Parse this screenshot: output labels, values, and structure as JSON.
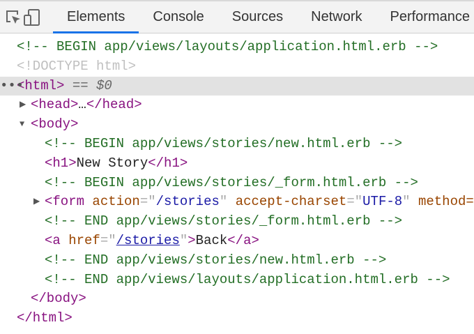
{
  "toolbar": {
    "tools": [
      {
        "icon": "inspect-element-icon"
      },
      {
        "icon": "device-toolbar-icon"
      }
    ],
    "tabs": [
      {
        "label": "Elements",
        "active": true
      },
      {
        "label": "Console"
      },
      {
        "label": "Sources"
      },
      {
        "label": "Network"
      },
      {
        "label": "Performance"
      }
    ],
    "accent_color": "#1a73e8"
  },
  "tree": {
    "lines": [
      {
        "indent": 0,
        "tokens": [
          {
            "t": "comment",
            "v": "<!-- BEGIN app/views/layouts/application.html.erb -->"
          }
        ]
      },
      {
        "indent": 0,
        "tokens": [
          {
            "t": "doctype",
            "v": "<!DOCTYPE html>"
          }
        ]
      },
      {
        "indent": 0,
        "selected": true,
        "dots": "•••",
        "tokens": [
          {
            "t": "tag",
            "v": "<html>"
          },
          {
            "t": "sel-eq",
            "v": " == "
          },
          {
            "t": "sel-var",
            "v": "$0"
          }
        ]
      },
      {
        "indent": 1,
        "arrow": "▶",
        "tokens": [
          {
            "t": "tag",
            "v": "<head>"
          },
          {
            "t": "text",
            "v": "…"
          },
          {
            "t": "tag",
            "v": "</head>"
          }
        ]
      },
      {
        "indent": 1,
        "arrow": "▼",
        "tokens": [
          {
            "t": "tag",
            "v": "<body>"
          }
        ]
      },
      {
        "indent": 2,
        "tokens": [
          {
            "t": "comment",
            "v": "<!-- BEGIN app/views/stories/new.html.erb -->"
          }
        ]
      },
      {
        "indent": 2,
        "tokens": [
          {
            "t": "tag",
            "v": "<h1>"
          },
          {
            "t": "text",
            "v": "New Story"
          },
          {
            "t": "tag",
            "v": "</h1>"
          }
        ]
      },
      {
        "indent": 2,
        "tokens": [
          {
            "t": "comment",
            "v": "<!-- BEGIN app/views/stories/_form.html.erb -->"
          }
        ]
      },
      {
        "indent": 2,
        "arrow": "▶",
        "tokens": [
          {
            "t": "tag",
            "v": "<form "
          },
          {
            "t": "attr",
            "v": "action"
          },
          {
            "t": "punct",
            "v": "=\""
          },
          {
            "t": "val",
            "v": "/stories"
          },
          {
            "t": "punct",
            "v": "\" "
          },
          {
            "t": "attr",
            "v": "accept-charset"
          },
          {
            "t": "punct",
            "v": "=\""
          },
          {
            "t": "val",
            "v": "UTF-8"
          },
          {
            "t": "punct",
            "v": "\" "
          },
          {
            "t": "attr",
            "v": "method="
          }
        ]
      },
      {
        "indent": 2,
        "tokens": [
          {
            "t": "comment",
            "v": "<!-- END app/views/stories/_form.html.erb -->"
          }
        ]
      },
      {
        "indent": 2,
        "tokens": [
          {
            "t": "tag",
            "v": "<a "
          },
          {
            "t": "attr",
            "v": "href"
          },
          {
            "t": "punct",
            "v": "=\""
          },
          {
            "t": "link",
            "v": "/stories"
          },
          {
            "t": "punct",
            "v": "\""
          },
          {
            "t": "tag",
            "v": ">"
          },
          {
            "t": "text",
            "v": "Back"
          },
          {
            "t": "tag",
            "v": "</a>"
          }
        ]
      },
      {
        "indent": 2,
        "tokens": [
          {
            "t": "comment",
            "v": "<!-- END app/views/stories/new.html.erb -->"
          }
        ]
      },
      {
        "indent": 2,
        "tokens": [
          {
            "t": "comment",
            "v": "<!-- END app/views/layouts/application.html.erb -->"
          }
        ]
      },
      {
        "indent": 1,
        "tokens": [
          {
            "t": "tag",
            "v": "</body>"
          }
        ]
      },
      {
        "indent": 0,
        "tokens": [
          {
            "t": "tag",
            "v": "</html>"
          }
        ]
      }
    ]
  }
}
